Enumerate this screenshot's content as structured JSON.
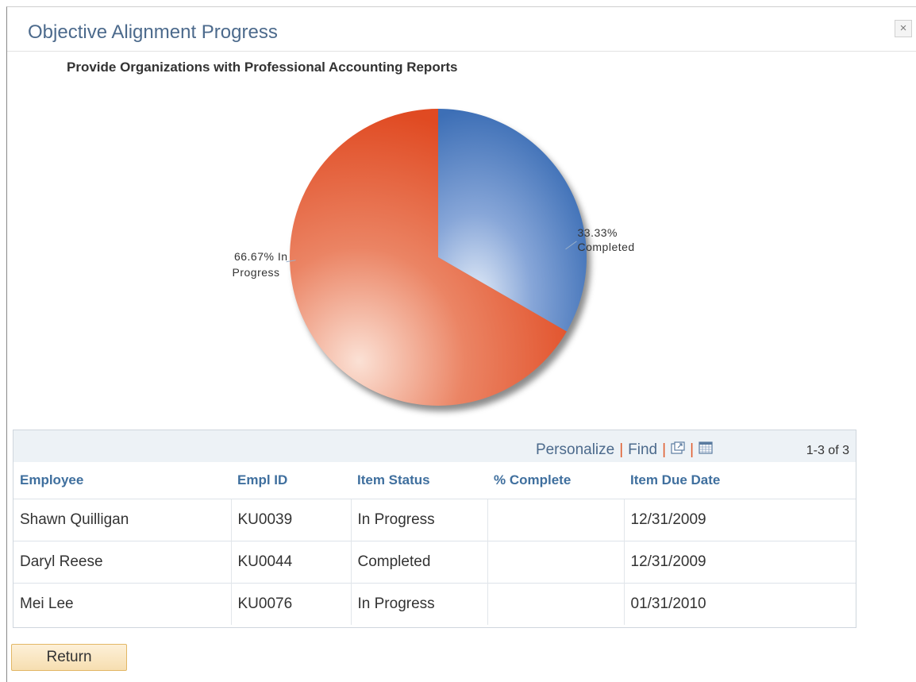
{
  "modal": {
    "title": "Objective Alignment Progress",
    "close_label": "×"
  },
  "chart": {
    "title": "Provide Organizations with Professional Accounting Reports"
  },
  "chart_data": {
    "type": "pie",
    "title": "Provide Organizations with Professional Accounting Reports",
    "slices": [
      {
        "label": "Completed",
        "value": 33.33,
        "display_pct": "33.33%",
        "display_label": "Completed",
        "color": "#3d6fb6"
      },
      {
        "label": "In Progress",
        "value": 66.67,
        "display_pct": "66.67% In",
        "display_label": "Progress",
        "color": "#e04a22"
      }
    ]
  },
  "grid": {
    "tools": {
      "personalize": "Personalize",
      "separator": "|",
      "find": "Find",
      "zoom_icon": "new-window-icon",
      "download_icon": "download-spreadsheet-icon"
    },
    "count": "1-3 of 3",
    "columns": [
      "Employee",
      "Empl ID",
      "Item Status",
      "% Complete",
      "Item Due Date"
    ],
    "rows": [
      [
        "Shawn Quilligan",
        "KU0039",
        "In Progress",
        "",
        "12/31/2009"
      ],
      [
        "Daryl Reese",
        "KU0044",
        "Completed",
        "",
        "12/31/2009"
      ],
      [
        "Mei Lee",
        "KU0076",
        "In Progress",
        "",
        "01/31/2010"
      ]
    ]
  },
  "actions": {
    "return_label": "Return"
  },
  "colors": {
    "title_blue": "#4c6a8c",
    "header_link": "#3f6f9e",
    "accent_orange": "#e05a2a"
  }
}
